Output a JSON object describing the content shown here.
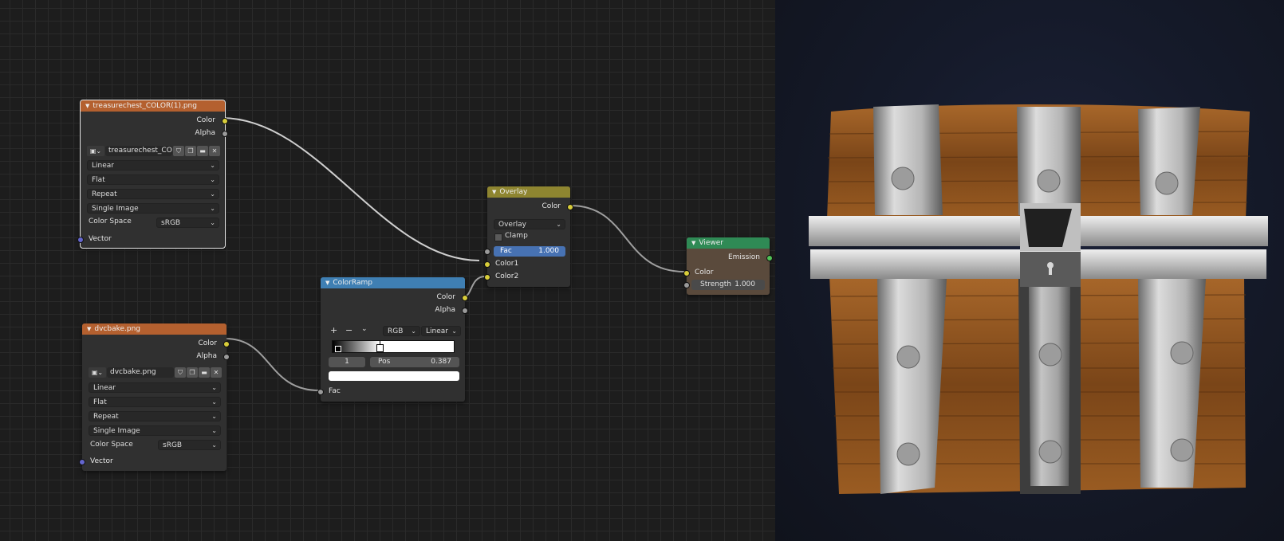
{
  "nodes": {
    "image1": {
      "title": "treasurechest_COLOR(1).png",
      "out_color": "Color",
      "out_alpha": "Alpha",
      "image_name": "treasurechest_CO...",
      "interpolation": "Linear",
      "projection": "Flat",
      "extension": "Repeat",
      "source": "Single Image",
      "color_space_label": "Color Space",
      "color_space": "sRGB",
      "in_vector": "Vector"
    },
    "image2": {
      "title": "dvcbake.png",
      "out_color": "Color",
      "out_alpha": "Alpha",
      "image_name": "dvcbake.png",
      "interpolation": "Linear",
      "projection": "Flat",
      "extension": "Repeat",
      "source": "Single Image",
      "color_space_label": "Color Space",
      "color_space": "sRGB",
      "in_vector": "Vector"
    },
    "colorramp": {
      "title": "ColorRamp",
      "out_color": "Color",
      "out_alpha": "Alpha",
      "add": "+",
      "remove": "−",
      "mode": "RGB",
      "interpolation": "Linear",
      "stop_index": "1",
      "pos_label": "Pos",
      "pos_value": "0.387",
      "stop_position": 0.387,
      "in_fac": "Fac"
    },
    "overlay": {
      "title": "Overlay",
      "out_color": "Color",
      "blend_mode": "Overlay",
      "clamp": "Clamp",
      "clamp_checked": false,
      "fac_label": "Fac",
      "fac_value": "1.000",
      "in_color1": "Color1",
      "in_color2": "Color2"
    },
    "viewer": {
      "title": "Viewer",
      "out_emission": "Emission",
      "in_color": "Color",
      "strength_label": "Strength",
      "strength_value": "1.000"
    }
  },
  "colors": {
    "editor_bg": "#1d1d1d",
    "image_header": "#b4602f",
    "ramp_header": "#3f7fb3",
    "overlay_header": "#8e8530",
    "viewer_header": "#2f8a55",
    "socket_color": "#d8cd3a",
    "socket_float": "#9a9a9a",
    "socket_vector": "#6466cf",
    "socket_shader": "#51c257",
    "slider_blue": "#4772b3",
    "wood": "#8a5424",
    "metal": "#b8b8b8"
  },
  "icons": [
    "image-icon",
    "fake-user-shield-icon",
    "duplicate-icon",
    "open-folder-icon",
    "close-icon",
    "chevron-down-icon",
    "collapse-triangle-icon"
  ]
}
